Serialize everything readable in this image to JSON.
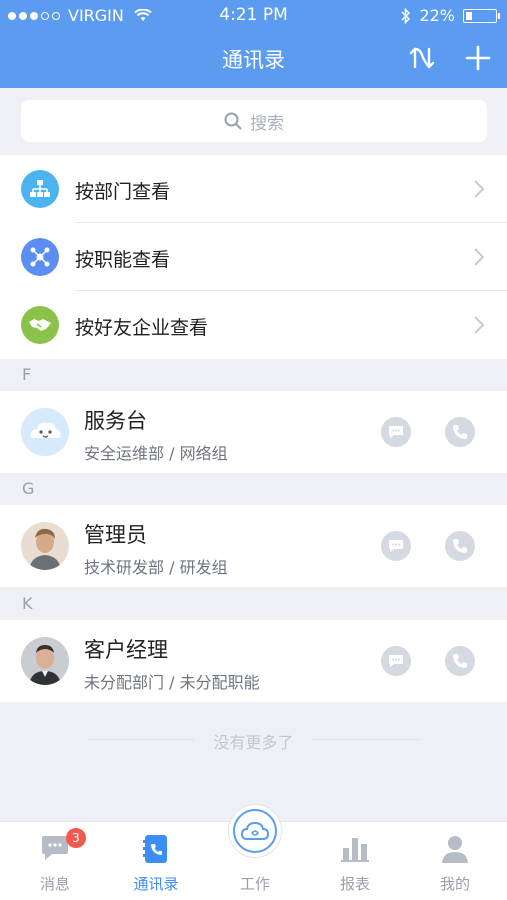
{
  "status_bar": {
    "carrier": "VIRGIN",
    "time": "4:21 PM",
    "battery": "22%",
    "battery_level": 0.22
  },
  "nav": {
    "title": "通讯录",
    "icons": [
      "sort-icon",
      "add-icon"
    ]
  },
  "search": {
    "placeholder": "搜索"
  },
  "menu": [
    {
      "label": "按部门查看",
      "icon": "org-chart-icon",
      "color": "#4bb4ef"
    },
    {
      "label": "按职能查看",
      "icon": "function-icon",
      "color": "#5b8ef0"
    },
    {
      "label": "按好友企业查看",
      "icon": "handshake-icon",
      "color": "#8bc34a"
    }
  ],
  "sections": [
    {
      "letter": "F",
      "contacts": [
        {
          "name": "服务台",
          "sub": "安全运维部 / 网络组",
          "avatar": "cloud-mascot-avatar"
        }
      ]
    },
    {
      "letter": "G",
      "contacts": [
        {
          "name": "管理员",
          "sub": "技术研发部 / 研发组",
          "avatar": "photo-avatar"
        }
      ]
    },
    {
      "letter": "K",
      "contacts": [
        {
          "name": "客户经理",
          "sub": "未分配部门 / 未分配职能",
          "avatar": "photo-avatar"
        }
      ]
    }
  ],
  "footer_text": "没有更多了",
  "tabbar": {
    "items": [
      {
        "label": "消息",
        "icon": "chat-icon",
        "badge": "3",
        "active": false
      },
      {
        "label": "通讯录",
        "icon": "contacts-icon",
        "active": true
      },
      {
        "label": "工作",
        "icon": "cloud-icon",
        "active": false
      },
      {
        "label": "报表",
        "icon": "bar-chart-icon",
        "active": false
      },
      {
        "label": "我的",
        "icon": "person-icon",
        "active": false
      }
    ]
  },
  "colors": {
    "primary": "#5b9cf0",
    "tab_active": "#3c8ef5",
    "badge": "#f35a4f"
  }
}
